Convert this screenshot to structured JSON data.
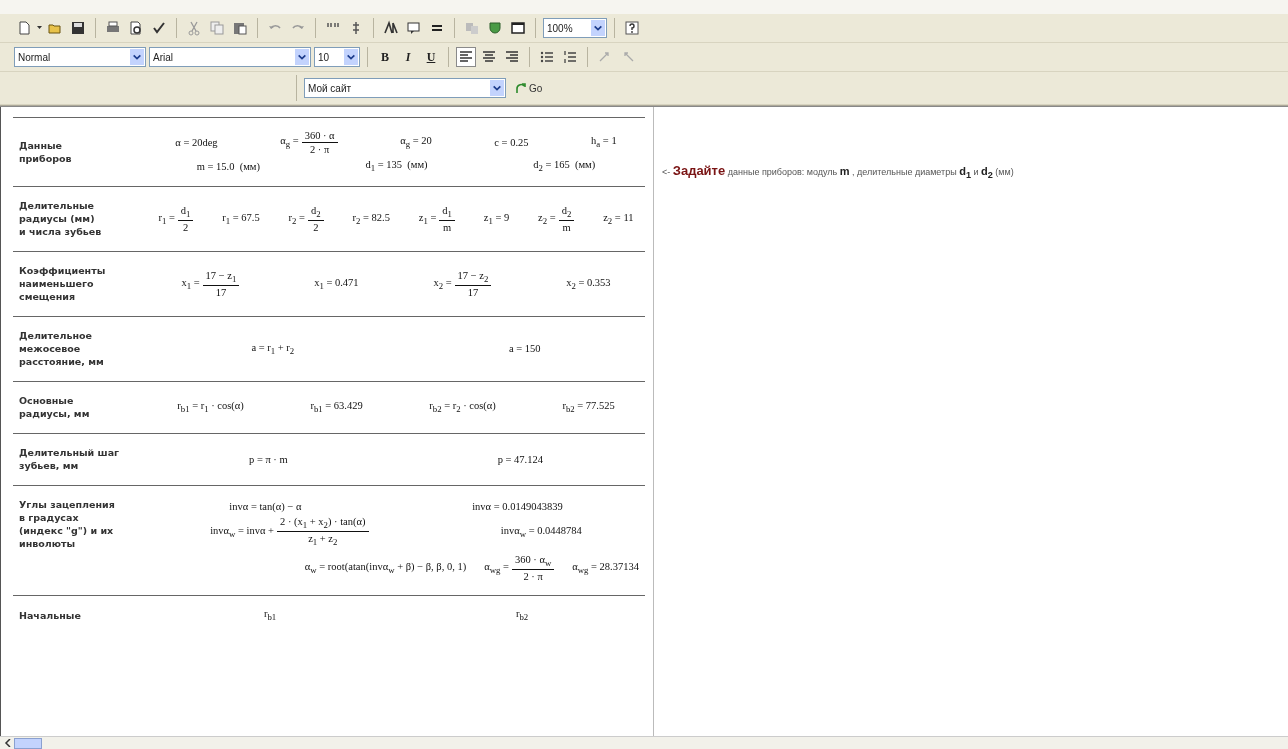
{
  "toolbar": {
    "zoom": "100%",
    "style": "Normal",
    "font": "Arial",
    "size": "10",
    "format_buttons": [
      "B",
      "I",
      "U"
    ],
    "alignment": [
      {
        "selected": true
      },
      {
        "selected": false
      },
      {
        "selected": false
      }
    ],
    "address": "Мой сайт",
    "go": "Go"
  },
  "worksheet": {
    "sections": [
      {
        "label": "Данные\nприборов",
        "lines": [
          [
            {
              "kind": "expr",
              "text": "α = 20deg"
            },
            {
              "kind": "frac",
              "lhs": "α$_{g}$ =",
              "num": "360 · α",
              "den": "2 · π"
            },
            {
              "kind": "expr",
              "text": "α$_{g}$ = 20"
            },
            {
              "kind": "expr",
              "text": "c = 0.25"
            },
            {
              "kind": "expr",
              "text": "h$_{a}$ = 1"
            }
          ],
          [
            {
              "kind": "expr",
              "text": "m = 15.0  (мм)"
            },
            {
              "kind": "expr",
              "text": "d$_{1}$ = 135  (мм)"
            },
            {
              "kind": "expr",
              "text": "d$_{2}$ = 165  (мм)"
            }
          ]
        ]
      },
      {
        "label": "Делительные\nрадиусы (мм)\nи числа зубьев",
        "lines": [
          [
            {
              "kind": "frac",
              "lhs": "r$_{1}$ =",
              "num": "d$_{1}$",
              "den": "2"
            },
            {
              "kind": "expr",
              "text": "r$_{1}$ = 67.5"
            },
            {
              "kind": "frac",
              "lhs": "r$_{2}$ =",
              "num": "d$_{2}$",
              "den": "2"
            },
            {
              "kind": "expr",
              "text": "r$_{2}$ = 82.5"
            },
            {
              "kind": "frac",
              "lhs": "z$_{1}$ =",
              "num": "d$_{1}$",
              "den": "m"
            },
            {
              "kind": "expr",
              "text": "z$_{1}$ = 9"
            },
            {
              "kind": "frac",
              "lhs": "z$_{2}$ =",
              "num": "d$_{2}$",
              "den": "m"
            },
            {
              "kind": "expr",
              "text": "z$_{2}$ = 11"
            }
          ]
        ]
      },
      {
        "label": "Коэффициенты\nнаименьшего\nсмещения",
        "lines": [
          [
            {
              "kind": "frac",
              "lhs": "x$_{1}$ =",
              "num": "17 − z$_{1}$",
              "den": "17"
            },
            {
              "kind": "expr",
              "text": "x$_{1}$ = 0.471"
            },
            {
              "kind": "frac",
              "lhs": "x$_{2}$ =",
              "num": "17 − z$_{2}$",
              "den": "17"
            },
            {
              "kind": "expr",
              "text": "x$_{2}$ = 0.353"
            }
          ]
        ]
      },
      {
        "label": "Делительное\nмежосевое расстояние, мм",
        "lines": [
          [
            {
              "kind": "expr",
              "text": "a = r$_{1}$ + r$_{2}$"
            },
            {
              "kind": "expr",
              "text": "a = 150"
            }
          ]
        ]
      },
      {
        "label": "Основные\nрадиусы, мм",
        "lines": [
          [
            {
              "kind": "expr",
              "text": "r$_{b1}$ = r$_{1}$ · cos(α)"
            },
            {
              "kind": "expr",
              "text": "r$_{b1}$ = 63.429"
            },
            {
              "kind": "expr",
              "text": "r$_{b2}$ = r$_{2}$ · cos(α)"
            },
            {
              "kind": "expr",
              "text": "r$_{b2}$ = 77.525"
            }
          ]
        ]
      },
      {
        "label": "Делительный шаг\nзубьев, мм",
        "lines": [
          [
            {
              "kind": "expr",
              "text": "p = π · m"
            },
            {
              "kind": "expr",
              "text": "p = 47.124"
            }
          ]
        ]
      },
      {
        "label": "Углы зацепления\nв градусах\n(индекс \"g\") и их\nинволюты",
        "lines": [
          [
            {
              "kind": "expr",
              "text": "invα = tan(α) − α"
            },
            {
              "kind": "expr",
              "text": "invα = 0.0149043839"
            }
          ],
          [
            {
              "kind": "frac",
              "lhs": "invα$_{w}$ = invα +",
              "num": "2 · (x$_{1}$ + x$_{2}$) · tan(α)",
              "den": "z$_{1}$ + z$_{2}$"
            },
            {
              "kind": "expr",
              "text": "invα$_{w}$ = 0.0448784"
            }
          ]
        ],
        "wide_lines": [
          [
            {
              "kind": "expr",
              "text": "α$_{w}$ = root(atan(invα$_{w}$ + β) − β, β, 0, 1)"
            },
            {
              "kind": "frac",
              "lhs": "α$_{wg}$ =",
              "num": "360 · α$_{w}$",
              "den": "2 · π"
            },
            {
              "kind": "expr",
              "text": "α$_{wg}$ = 28.37134"
            }
          ]
        ]
      },
      {
        "label": "Начальные",
        "lines": [
          [
            {
              "kind": "expr",
              "text": "r$_{b1}$"
            },
            {
              "kind": "expr",
              "text": "r$_{b2}$"
            }
          ]
        ]
      }
    ]
  },
  "note": "<- **Задайте** данные приборов: модуль **m** , делительные диаметры **d$_{1}$** и **d$_{2}$** (мм)"
}
